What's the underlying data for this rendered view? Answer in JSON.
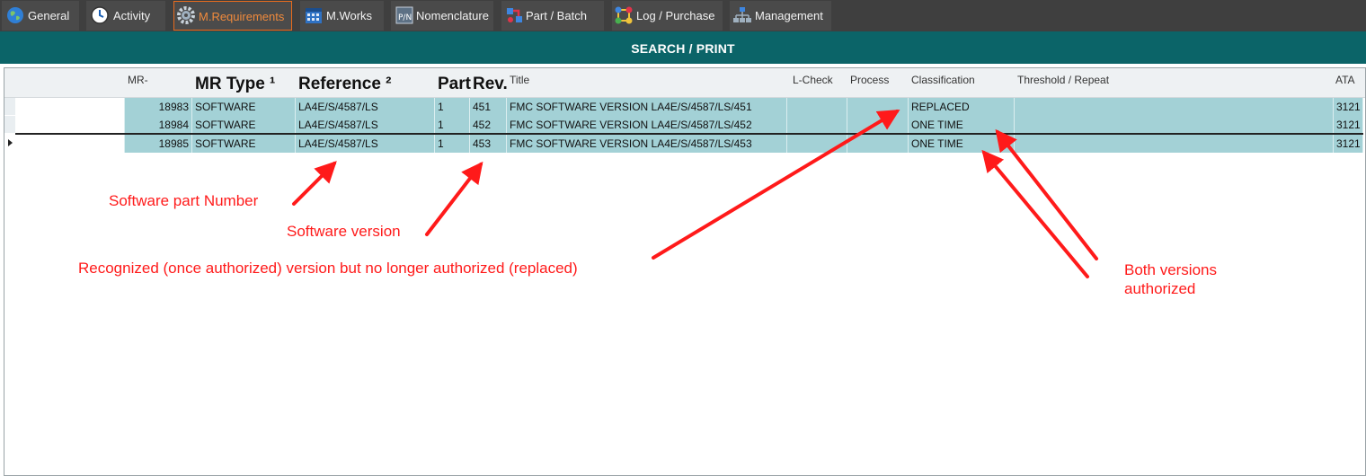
{
  "tabs": [
    {
      "label": "General",
      "icon": "globe-icon",
      "active": false
    },
    {
      "label": "Activity",
      "icon": "clock-icon",
      "active": false
    },
    {
      "label": "M.Requirements",
      "icon": "gear-icon",
      "active": true
    },
    {
      "label": "M.Works",
      "icon": "calendar-icon",
      "active": false
    },
    {
      "label": "Nomenclature",
      "icon": "pn-tag-icon",
      "active": false
    },
    {
      "label": "Part / Batch",
      "icon": "part-icon",
      "active": false
    },
    {
      "label": "Log / Purchase",
      "icon": "network-icon",
      "active": false
    },
    {
      "label": "Management",
      "icon": "org-chart-icon",
      "active": false
    }
  ],
  "colors": {
    "tabbar": "#3f3f3f",
    "active_tab_text": "#f08a3c",
    "header": "#0b6468",
    "row_fill": "#a3d1d6",
    "annotation": "#ff1a1a"
  },
  "section_title": "SEARCH / PRINT",
  "grid": {
    "columns": {
      "mr": "MR-",
      "mr_type": "MR Type ¹",
      "reference": "Reference ²",
      "part": "Part",
      "rev": "Rev.",
      "title": "Title",
      "l_check": "L-Check",
      "process": "Process",
      "classification": "Classification",
      "threshold": "Threshold / Repeat",
      "ata": "ATA"
    },
    "rows": [
      {
        "mr": "18983",
        "mr_type": "SOFTWARE",
        "reference": "LA4E/S/4587/LS",
        "part": "1",
        "rev": "451",
        "title": "FMC SOFTWARE VERSION LA4E/S/4587/LS/451",
        "l_check": "",
        "process": "",
        "classification": "REPLACED",
        "threshold": "",
        "ata": "3121"
      },
      {
        "mr": "18984",
        "mr_type": "SOFTWARE",
        "reference": "LA4E/S/4587/LS",
        "part": "1",
        "rev": "452",
        "title": "FMC SOFTWARE VERSION LA4E/S/4587/LS/452",
        "l_check": "",
        "process": "",
        "classification": "ONE TIME",
        "threshold": "",
        "ata": "3121"
      },
      {
        "mr": "18985",
        "mr_type": "SOFTWARE",
        "reference": "LA4E/S/4587/LS",
        "part": "1",
        "rev": "453",
        "title": "FMC SOFTWARE VERSION LA4E/S/4587/LS/453",
        "l_check": "",
        "process": "",
        "classification": "ONE TIME",
        "threshold": "",
        "ata": "3121",
        "current": true
      }
    ]
  },
  "annotations": {
    "software_part_number": "Software part Number",
    "software_version": "Software version",
    "replaced_note": "Recognized (once authorized) version but no longer authorized (replaced)",
    "both_line1": "Both versions",
    "both_line2": "authorized"
  }
}
